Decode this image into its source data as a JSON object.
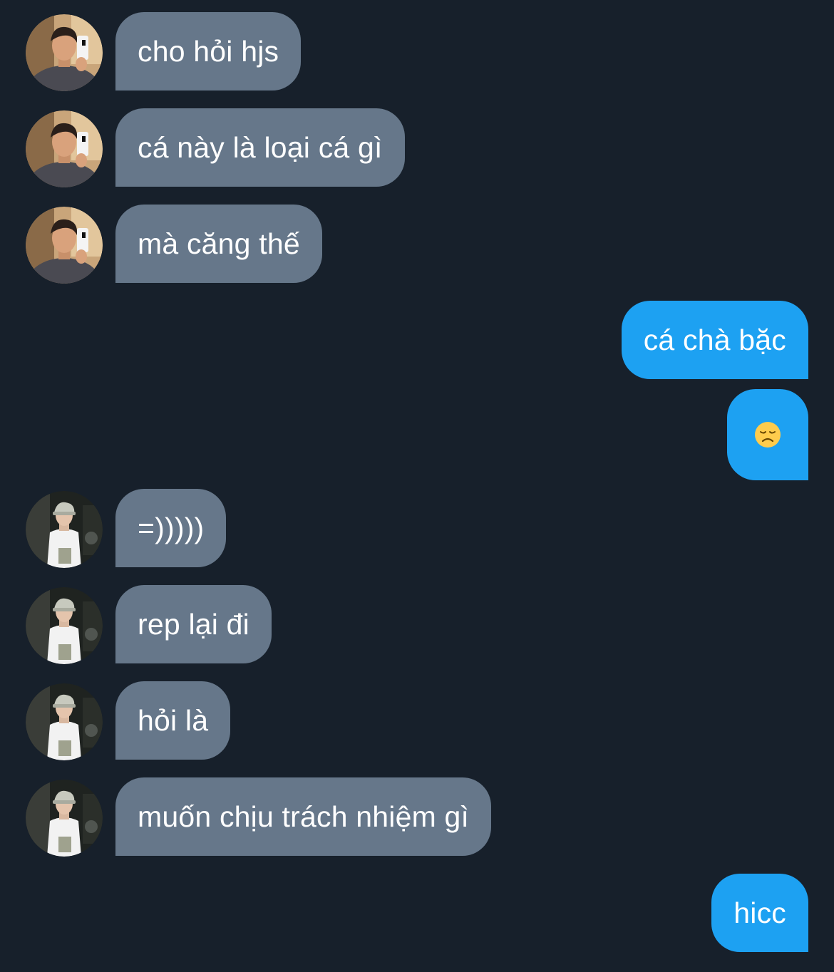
{
  "conversation": {
    "messages": [
      {
        "sender": "contact_1",
        "direction": "incoming",
        "text": "cho hỏi hjs"
      },
      {
        "sender": "contact_1",
        "direction": "incoming",
        "text": "cá này là loại cá gì"
      },
      {
        "sender": "contact_1",
        "direction": "incoming",
        "text": "mà căng thế"
      },
      {
        "sender": "me",
        "direction": "outgoing",
        "text": "cá chà bặc"
      },
      {
        "sender": "me",
        "direction": "outgoing",
        "emoji": "disappointed-face"
      },
      {
        "sender": "contact_2",
        "direction": "incoming",
        "text": "=)))))"
      },
      {
        "sender": "contact_2",
        "direction": "incoming",
        "text": "rep lại đi"
      },
      {
        "sender": "contact_2",
        "direction": "incoming",
        "text": "hỏi là"
      },
      {
        "sender": "contact_2",
        "direction": "incoming",
        "text": "muốn chịu trách nhiệm gì"
      },
      {
        "sender": "me",
        "direction": "outgoing",
        "text": "hicc"
      }
    ]
  },
  "colors": {
    "background": "#17202b",
    "incoming_bubble": "#66778a",
    "outgoing_bubble": "#1da1f2",
    "text": "#ffffff"
  }
}
